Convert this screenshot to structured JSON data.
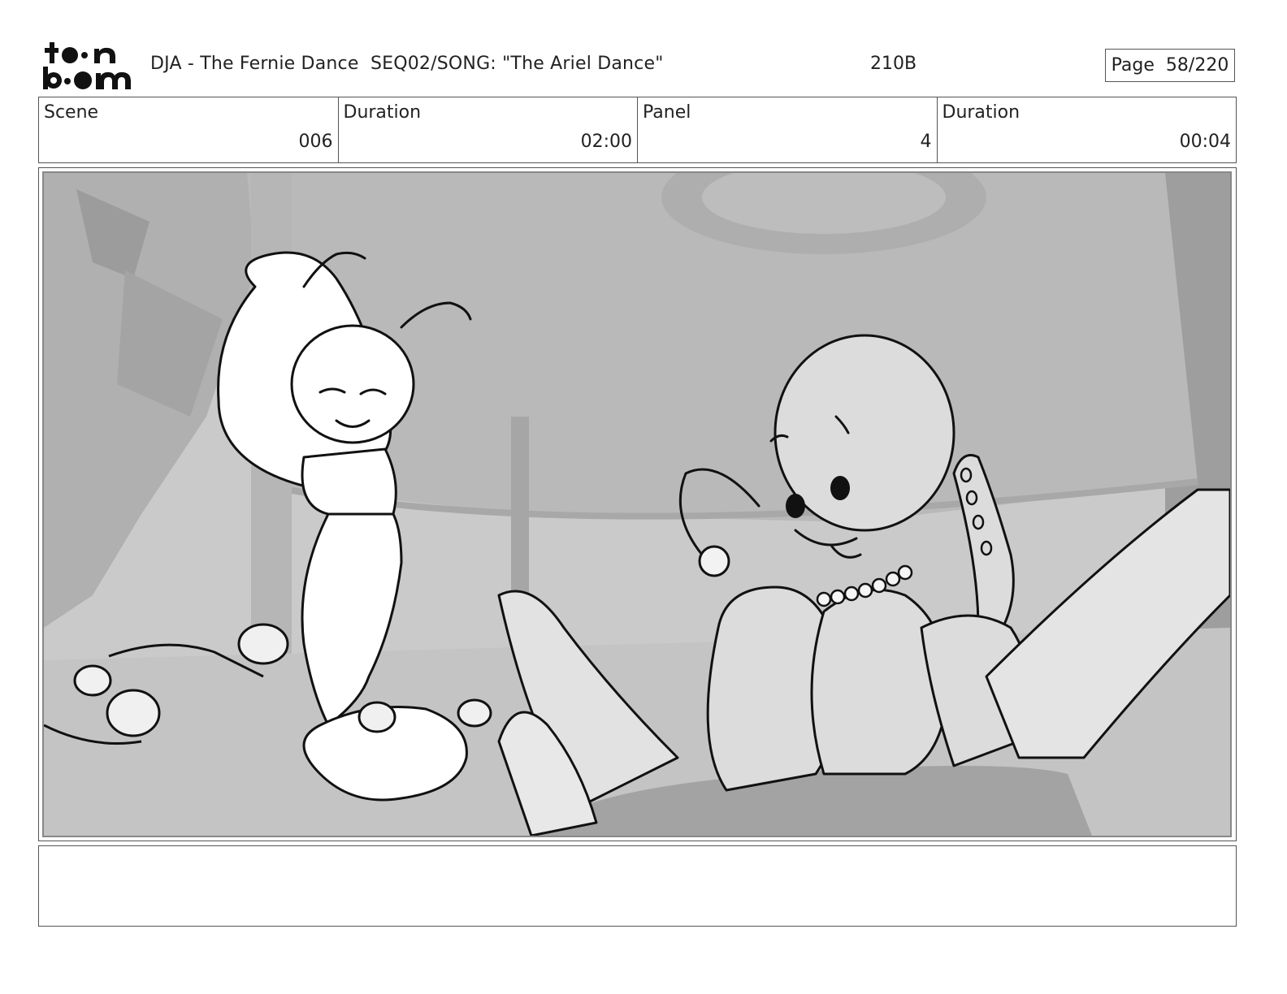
{
  "header": {
    "logo_text": "toon boom",
    "title": "DJA - The Fernie Dance  SEQ02/SONG: \"The Ariel Dance\"",
    "code": "210B",
    "page_label": "Page",
    "page_value": "58/220"
  },
  "info": [
    {
      "label": "Scene",
      "value": "006"
    },
    {
      "label": "Duration",
      "value": "02:00"
    },
    {
      "label": "Panel",
      "value": "4"
    },
    {
      "label": "Duration",
      "value": "00:04"
    }
  ],
  "notes": ""
}
